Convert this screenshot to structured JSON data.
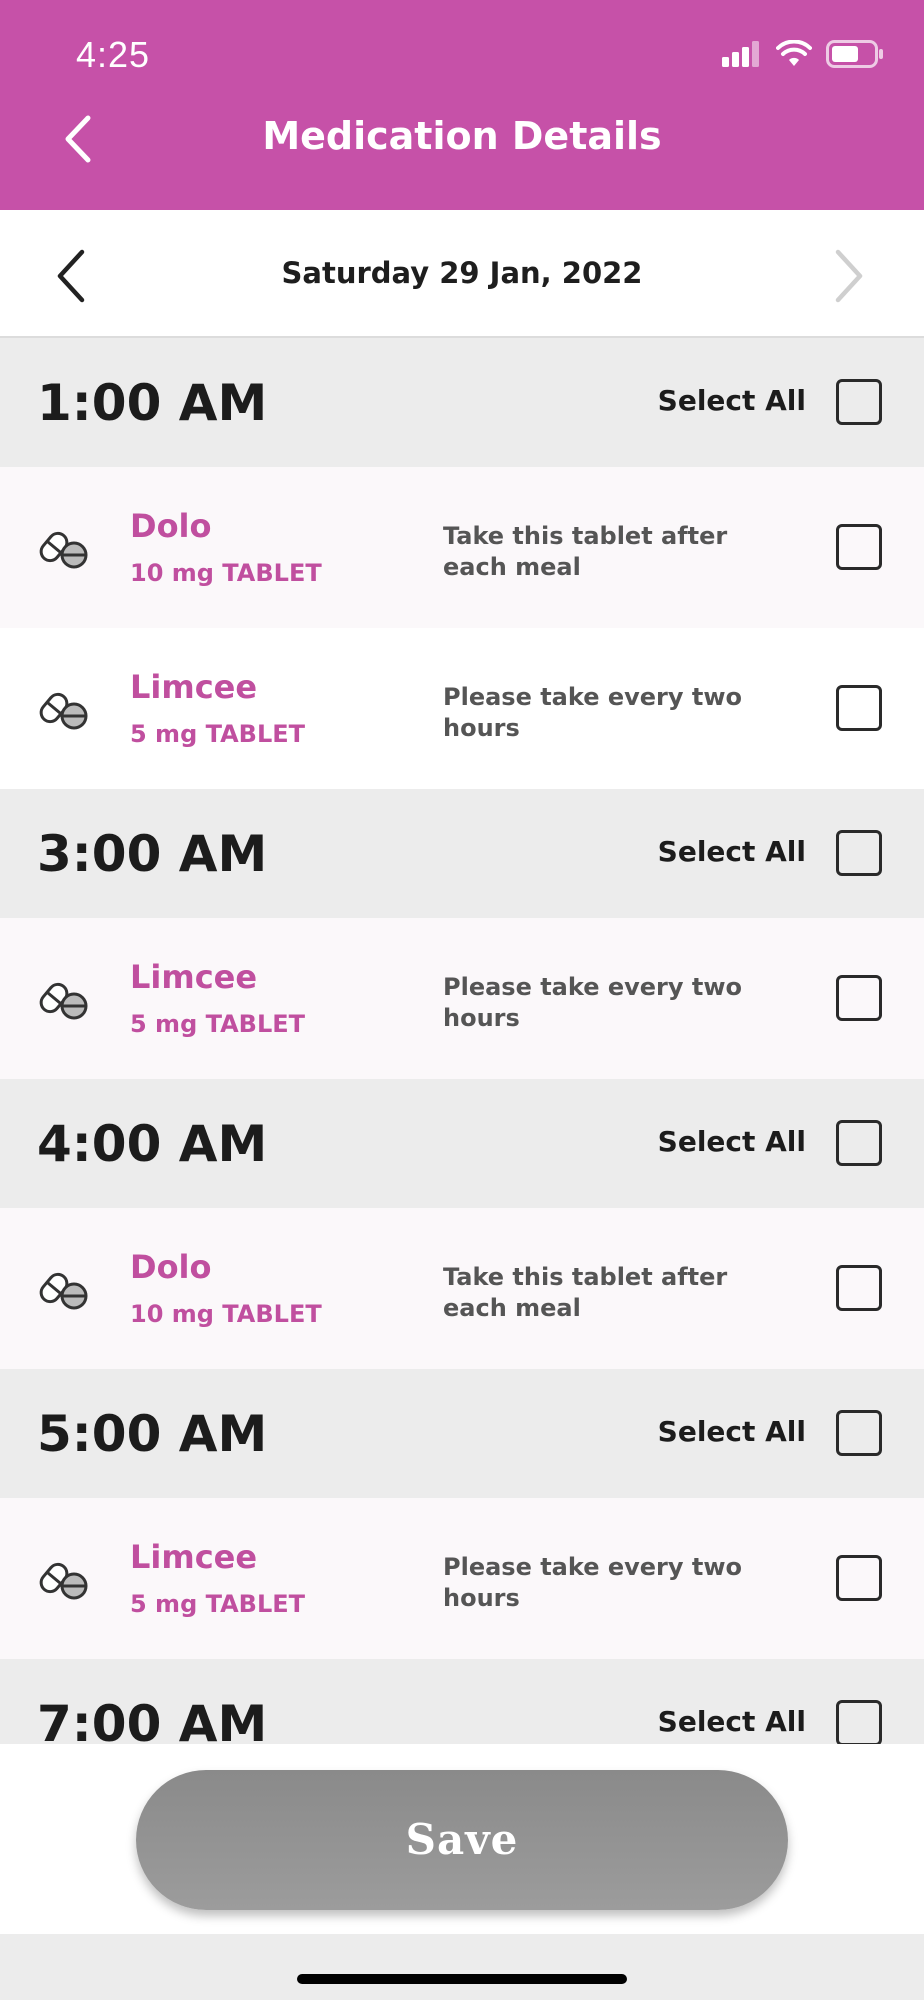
{
  "status_bar": {
    "time": "4:25"
  },
  "header": {
    "title": "Medication Details"
  },
  "date_nav": {
    "date": "Saturday 29 Jan, 2022"
  },
  "select_all_label": "Select All",
  "slots": [
    {
      "time": "1:00 AM",
      "meds": [
        {
          "name": "Dolo",
          "dose": "10 mg TABLET",
          "note": "Take this tablet after each meal"
        },
        {
          "name": "Limcee",
          "dose": "5 mg TABLET",
          "note": "Please take every two hours"
        }
      ]
    },
    {
      "time": "3:00 AM",
      "meds": [
        {
          "name": "Limcee",
          "dose": "5 mg TABLET",
          "note": "Please take every two hours"
        }
      ]
    },
    {
      "time": "4:00 AM",
      "meds": [
        {
          "name": "Dolo",
          "dose": "10 mg TABLET",
          "note": "Take this tablet after each meal"
        }
      ]
    },
    {
      "time": "5:00 AM",
      "meds": [
        {
          "name": "Limcee",
          "dose": "5 mg TABLET",
          "note": "Please take every two hours"
        }
      ]
    },
    {
      "time": "7:00 AM",
      "meds": []
    }
  ],
  "footer": {
    "save_label": "Save"
  },
  "colors": {
    "header_bg": "#c651a8",
    "med_text": "#c04f9f",
    "save_bg": "#8a8a8a"
  }
}
